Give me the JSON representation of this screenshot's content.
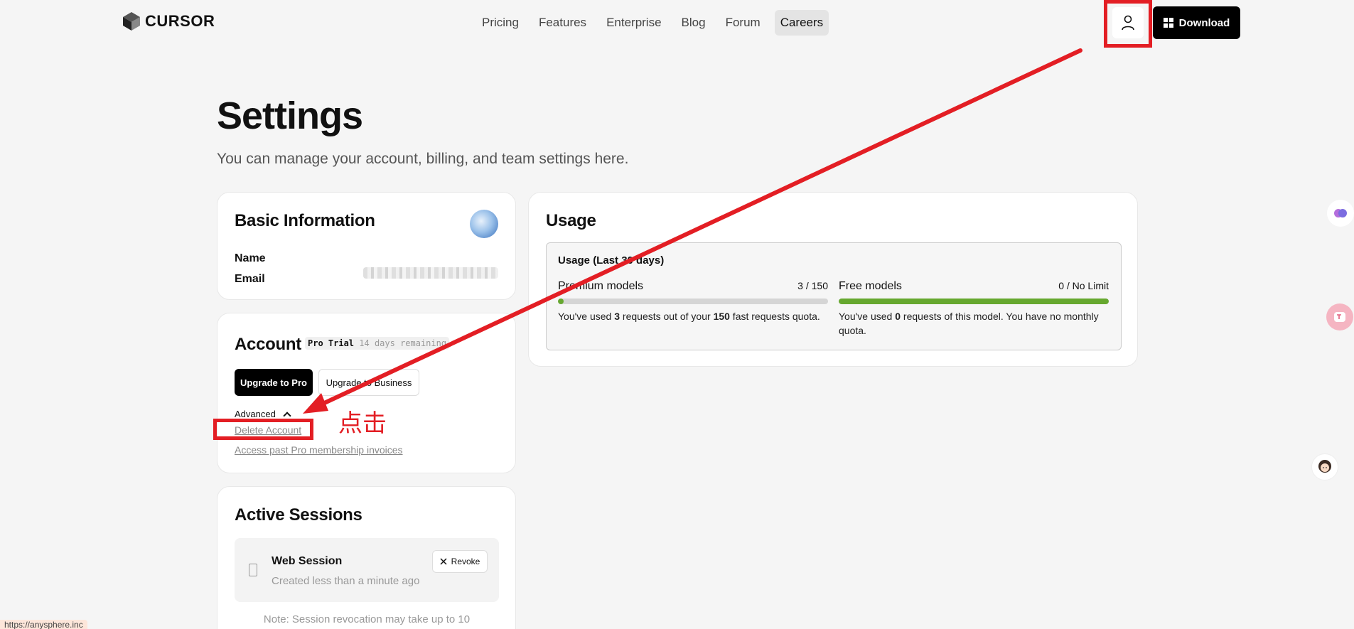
{
  "nav": {
    "logo_text": "CURSOR",
    "links": [
      "Pricing",
      "Features",
      "Enterprise",
      "Blog",
      "Forum",
      "Careers"
    ],
    "active_link": "Careers",
    "download_label": "Download"
  },
  "header": {
    "title": "Settings",
    "subtitle": "You can manage your account, billing, and team settings here."
  },
  "basic_info": {
    "title": "Basic Information",
    "name_label": "Name",
    "email_label": "Email"
  },
  "account": {
    "title": "Account",
    "plan_badge": "Pro Trial",
    "plan_remaining": "14 days remaining",
    "upgrade_pro_label": "Upgrade to Pro",
    "upgrade_business_label": "Upgrade to Business",
    "advanced_label": "Advanced",
    "delete_account_label": "Delete Account",
    "invoices_label": "Access past Pro membership invoices"
  },
  "sessions": {
    "title": "Active Sessions",
    "items": [
      {
        "title": "Web Session",
        "subtitle": "Created less than a minute ago",
        "revoke_label": "Revoke"
      }
    ],
    "note": "Note: Session revocation may take up to 10"
  },
  "usage": {
    "title": "Usage",
    "box_title": "Usage (Last 30 days)",
    "premium": {
      "name": "Premium models",
      "count": "3 / 150",
      "used": 3,
      "limit": 150,
      "desc_pre": "You've used ",
      "desc_used": "3",
      "desc_mid": " requests out of your ",
      "desc_limit": "150",
      "desc_post": " fast requests quota."
    },
    "free": {
      "name": "Free models",
      "count": "0 / No Limit",
      "fill_fraction": 1,
      "desc_pre": "You've used ",
      "desc_used": "0",
      "desc_post": " requests of this model. You have no monthly quota."
    }
  },
  "status_bar": {
    "url": "https://anysphere.inc"
  },
  "annotation": {
    "text": "点击"
  },
  "colors": {
    "accent_green": "#66a82f",
    "annotation_red": "#e31e24",
    "download_bg": "#000000"
  }
}
